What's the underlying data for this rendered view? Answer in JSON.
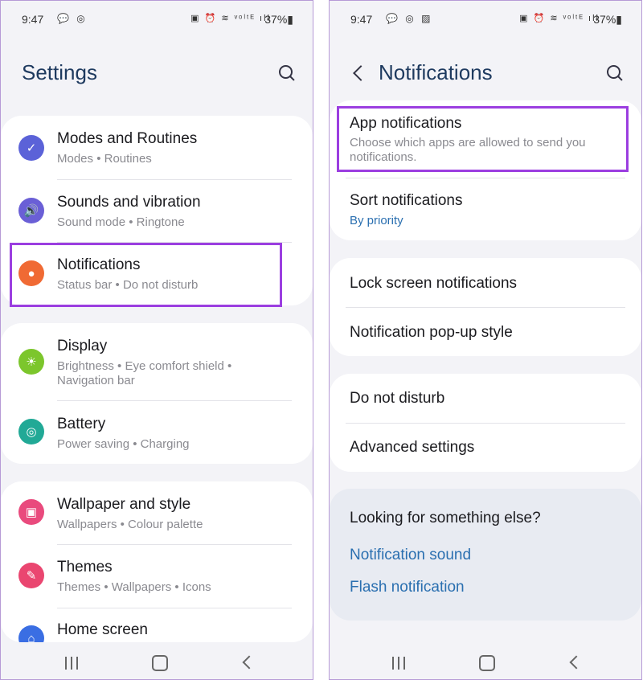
{
  "left": {
    "status": {
      "time": "9:47",
      "icons_left": "💬 ◎",
      "icons_right": "▣ ⏰ ≋ ᵛᵒˡᵗᴱ ıll",
      "battery": "37%▮"
    },
    "header": {
      "title": "Settings"
    },
    "groups": [
      {
        "items": [
          {
            "title": "Modes and Routines",
            "subtitle": "Modes  •  Routines",
            "icon": "check-circle-icon",
            "color": "#5b62d8"
          },
          {
            "title": "Sounds and vibration",
            "subtitle": "Sound mode  •  Ringtone",
            "icon": "speaker-icon",
            "color": "#6a5fd6"
          },
          {
            "title": "Notifications",
            "subtitle": "Status bar  •  Do not disturb",
            "icon": "notification-badge-icon",
            "color": "#f06a34"
          }
        ]
      },
      {
        "items": [
          {
            "title": "Display",
            "subtitle": "Brightness  •  Eye comfort shield  •",
            "subtitle2": "Navigation bar",
            "icon": "sun-icon",
            "color": "#7cc62c"
          },
          {
            "title": "Battery",
            "subtitle": "Power saving  •  Charging",
            "icon": "battery-cycle-icon",
            "color": "#21a996"
          }
        ]
      },
      {
        "items": [
          {
            "title": "Wallpaper and style",
            "subtitle": "Wallpapers  •  Colour palette",
            "icon": "image-icon",
            "color": "#e94a7d"
          },
          {
            "title": "Themes",
            "subtitle": "Themes  •  Wallpapers  •  Icons",
            "icon": "brush-icon",
            "color": "#ea4670"
          },
          {
            "title": "Home screen",
            "subtitle": "",
            "icon": "home-icon",
            "color": "#3a6ee3"
          }
        ]
      }
    ]
  },
  "right": {
    "status": {
      "time": "9:47",
      "icons_left": "💬 ◎ ▨",
      "icons_right": "▣ ⏰ ≋ ᵛᵒˡᵗᴱ ıll",
      "battery": "37%▮"
    },
    "header": {
      "title": "Notifications"
    },
    "card1": [
      {
        "title": "App notifications",
        "subtitle": "Choose which apps are allowed to send you",
        "subtitle2": "notifications."
      },
      {
        "title": "Sort notifications",
        "subtitle": "By priority"
      }
    ],
    "card2": [
      {
        "title": "Lock screen notifications"
      },
      {
        "title": "Notification pop-up style"
      }
    ],
    "card3": [
      {
        "title": "Do not disturb"
      },
      {
        "title": "Advanced settings"
      }
    ],
    "looking": {
      "title": "Looking for something else?",
      "links": [
        "Notification sound",
        "Flash notification"
      ]
    }
  },
  "colors": {
    "highlight": "#9b3ee0",
    "accent_link": "#2a6fb0",
    "title": "#1e3a5f"
  }
}
